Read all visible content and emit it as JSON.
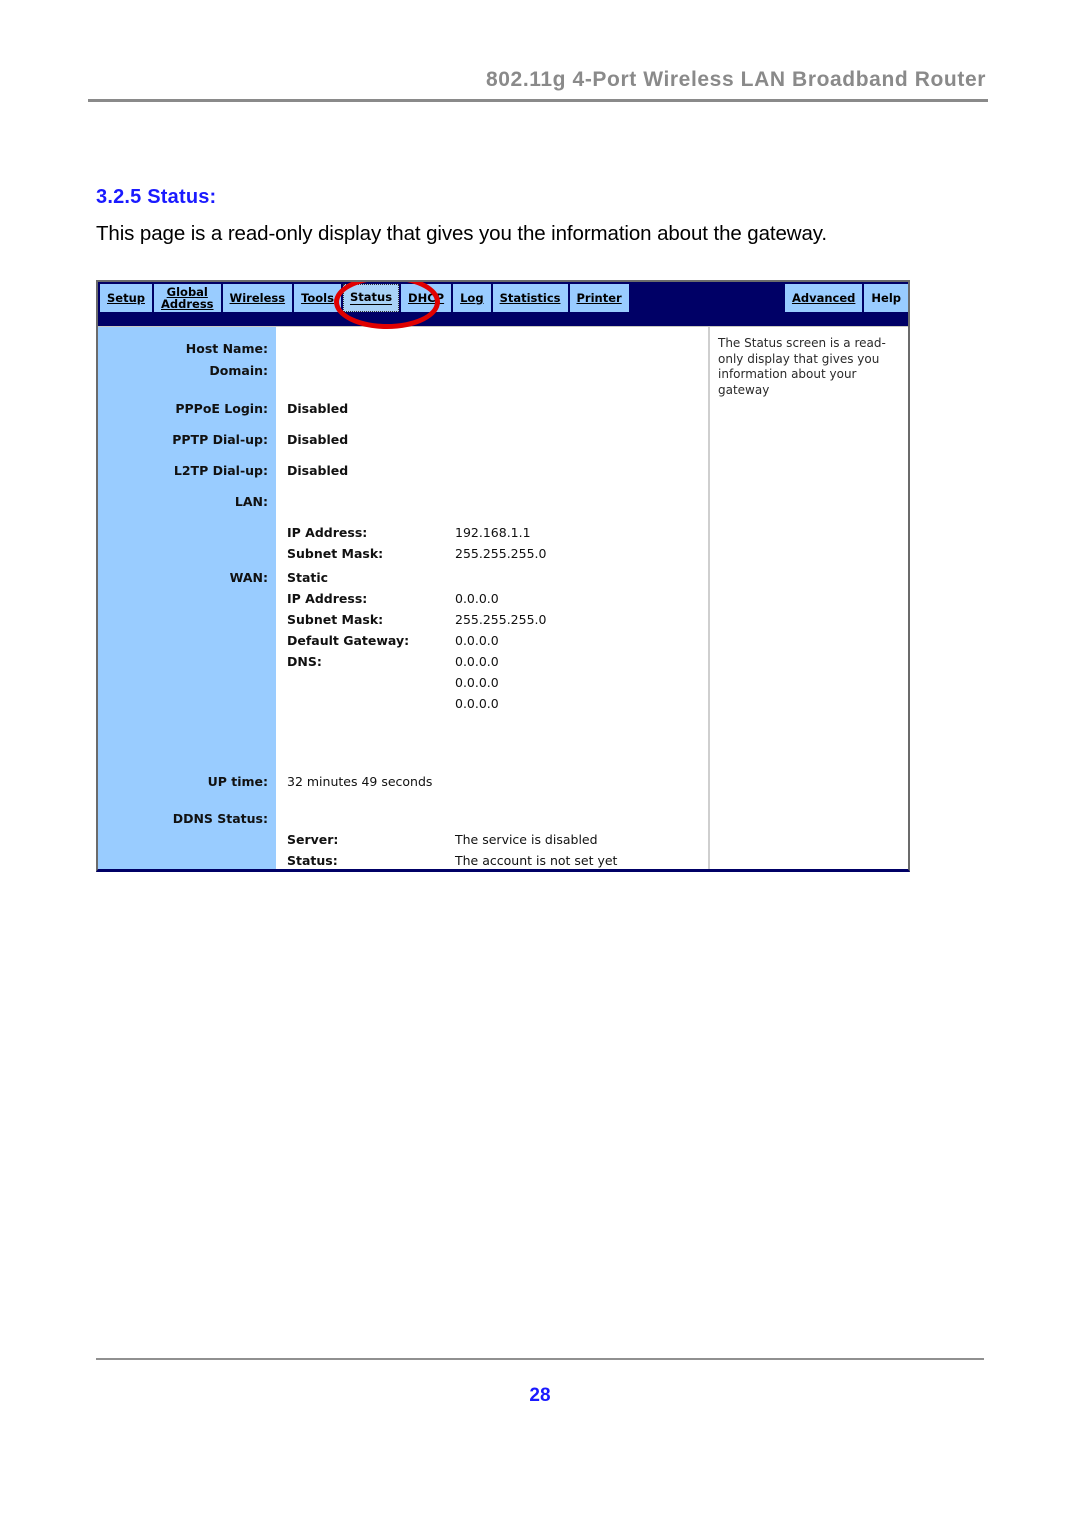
{
  "document": {
    "header_title": "802.11g 4-Port Wireless LAN Broadband Router",
    "section_heading": "3.2.5 Status:",
    "intro_paragraph": "This page is a read-only display that gives you the information about the gateway.",
    "page_number": "28",
    "accent_color": "#1a1aff",
    "header_color": "#8a8a8a"
  },
  "router_ui": {
    "nav": {
      "tabs": [
        {
          "label": "Setup",
          "selected": false
        },
        {
          "label_line1": "Global",
          "label_line2": "Address",
          "selected": false
        },
        {
          "label": "Wireless",
          "selected": false
        },
        {
          "label": "Tools",
          "selected": false
        },
        {
          "label": "Status",
          "selected": true
        },
        {
          "label": "DHCP",
          "selected": false
        },
        {
          "label": "Log",
          "selected": false
        },
        {
          "label": "Statistics",
          "selected": false
        },
        {
          "label": "Printer",
          "selected": false
        }
      ],
      "right_tabs": [
        {
          "label": "Advanced",
          "selected": false
        },
        {
          "label": "Help",
          "selected": false,
          "plain": true
        }
      ],
      "bar_color": "#000066",
      "tab_color": "#99ccff",
      "highlight_target": "Status",
      "highlight_color": "#e00000"
    },
    "status": {
      "host_name_label": "Host Name:",
      "host_name_value": "",
      "domain_label": "Domain:",
      "domain_value": "",
      "pppoe_label": "PPPoE Login:",
      "pppoe_value": "Disabled",
      "pptp_label": "PPTP Dial-up:",
      "pptp_value": "Disabled",
      "l2tp_label": "L2TP Dial-up:",
      "l2tp_value": "Disabled",
      "lan_label": "LAN:",
      "lan": {
        "ip_label": "IP Address:",
        "ip_value": "192.168.1.1",
        "mask_label": "Subnet Mask:",
        "mask_value": "255.255.255.0"
      },
      "wan_label": "WAN:",
      "wan": {
        "mode": "Static",
        "ip_label": "IP Address:",
        "ip_value": "0.0.0.0",
        "mask_label": "Subnet Mask:",
        "mask_value": "255.255.255.0",
        "gateway_label": "Default Gateway:",
        "gateway_value": "0.0.0.0",
        "dns_label": "DNS:",
        "dns_value_1": "0.0.0.0",
        "dns_value_2": "0.0.0.0",
        "dns_value_3": "0.0.0.0"
      },
      "uptime_label": "UP time:",
      "uptime_value": "32 minutes 49 seconds",
      "ddns_label": "DDNS Status:",
      "ddns": {
        "server_label": "Server:",
        "server_value": "The service is disabled",
        "status_label": "Status:",
        "status_value": "The account is not set yet"
      }
    },
    "help_panel": {
      "text": "The Status screen is a read-only display that gives you information about your gateway"
    }
  }
}
